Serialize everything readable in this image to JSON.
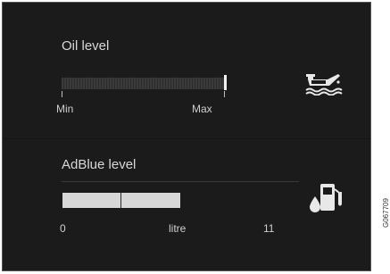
{
  "oil": {
    "title": "Oil level",
    "min_label": "Min",
    "max_label": "Max",
    "icon": "oil-can-icon"
  },
  "adblue": {
    "title": "AdBlue level",
    "scale_min": "0",
    "scale_unit": "litre",
    "scale_max": "11",
    "icon": "fuel-pump-drop-icon"
  },
  "figure_code": "G067709",
  "colors": {
    "background": "#1b1b1b",
    "text": "#d8d8d8",
    "bar": "#d7d7d7"
  }
}
